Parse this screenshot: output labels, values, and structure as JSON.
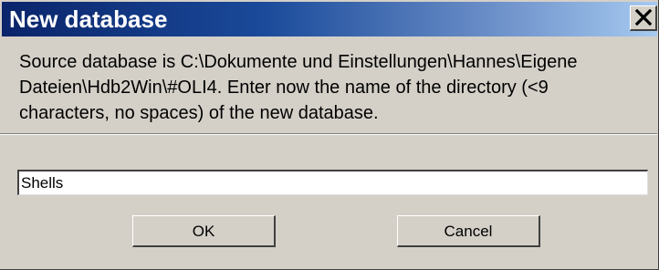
{
  "window": {
    "title": "New database",
    "close_icon": "close-icon"
  },
  "message": {
    "text": "Source database is C:\\Dokumente und Einstellungen\\Hannes\\Eigene Dateien\\Hdb2Win\\#OLI4. Enter now the name of the directory (<9 characters, no spaces) of the new database."
  },
  "input": {
    "value": "Shells"
  },
  "buttons": {
    "ok_label": "OK",
    "cancel_label": "Cancel"
  },
  "colors": {
    "titlebar_start": "#0a246a",
    "titlebar_end": "#a6caf0",
    "dialog_bg": "#d4d0c8"
  }
}
